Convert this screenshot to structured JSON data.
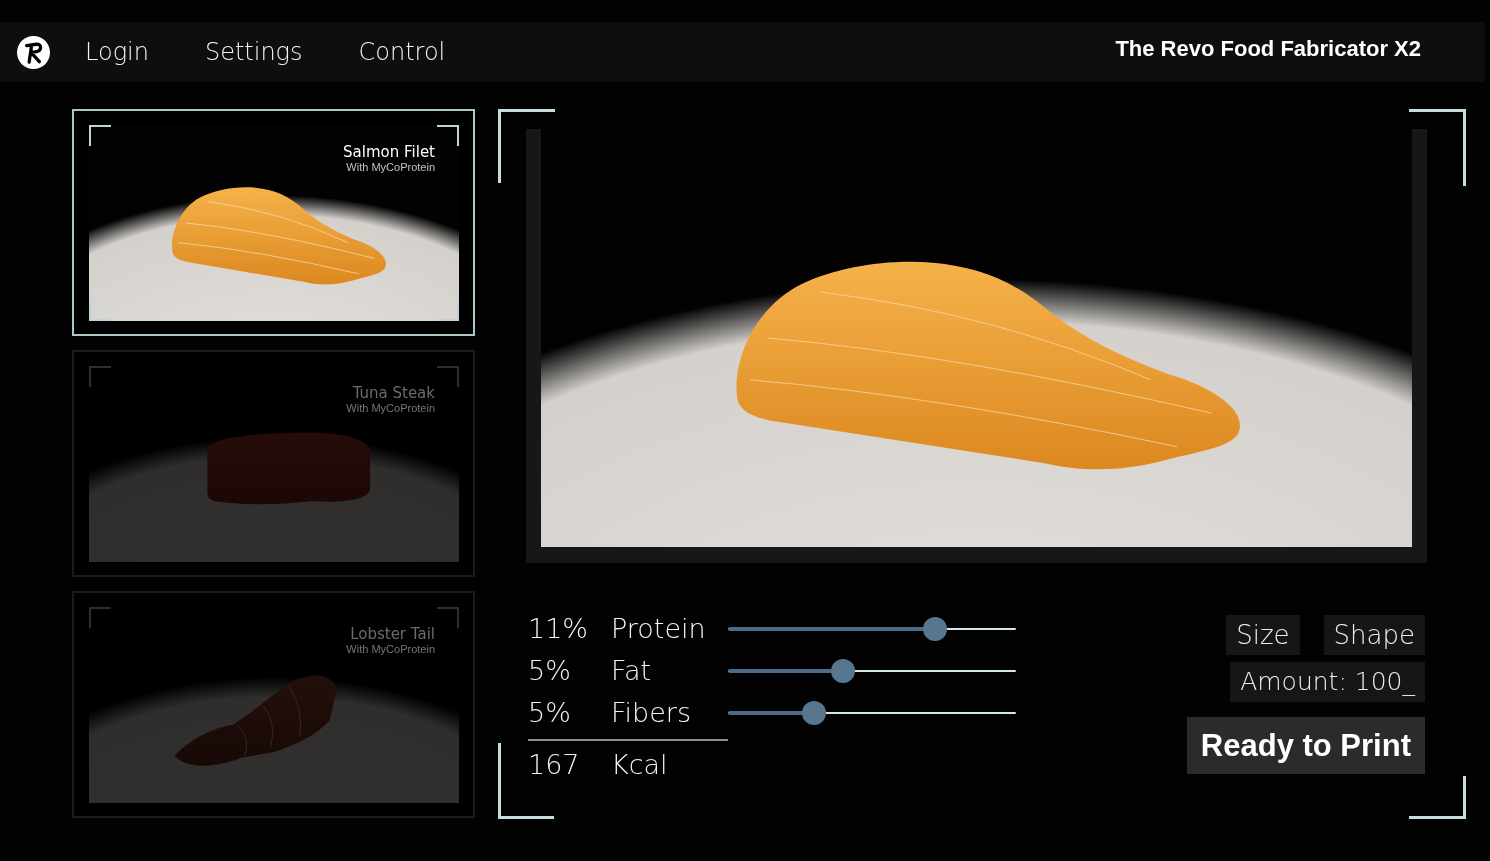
{
  "topbar": {
    "nav": [
      {
        "label": "Login"
      },
      {
        "label": "Settings"
      },
      {
        "label": "Control"
      }
    ],
    "title": "The Revo Food Fabricator X2"
  },
  "recipes": [
    {
      "kind": "salmon",
      "title": "Salmon Filet",
      "subtitle": "With MyCoProtein",
      "selected": true
    },
    {
      "kind": "tuna",
      "title": "Tuna Steak",
      "subtitle": "With MyCoProtein",
      "selected": false
    },
    {
      "kind": "lobster",
      "title": "Lobster Tail",
      "subtitle": "With MyCoProtein",
      "selected": false
    }
  ],
  "preview": {
    "kind": "salmon"
  },
  "nutrients": [
    {
      "percent": "11%",
      "name": "Protein",
      "level": 0.72
    },
    {
      "percent": "5%",
      "name": "Fat",
      "level": 0.4
    },
    {
      "percent": "5%",
      "name": "Fibers",
      "level": 0.3
    }
  ],
  "energy": {
    "value": "167",
    "unit": "Kcal"
  },
  "options": [
    {
      "label": "Size"
    },
    {
      "label": "Shape"
    }
  ],
  "amount": {
    "label": "Amount:",
    "value": "100_"
  },
  "print_button": {
    "label": "Ready to Print"
  }
}
